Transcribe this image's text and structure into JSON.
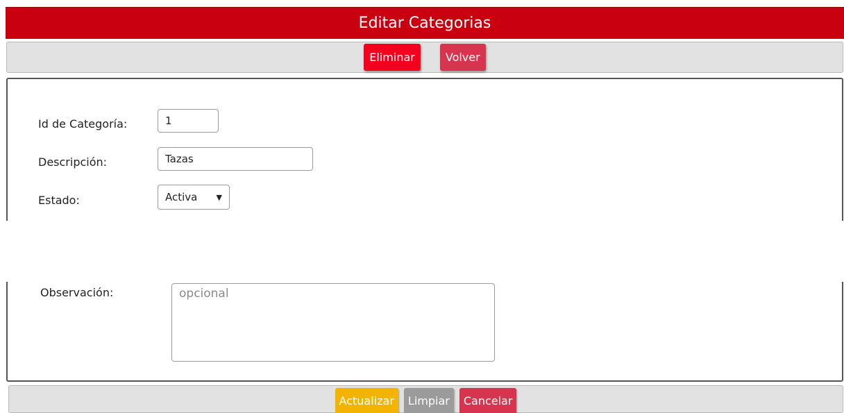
{
  "header": {
    "title": "Editar Categorias"
  },
  "toolbar": {
    "delete_label": "Eliminar",
    "back_label": "Volver"
  },
  "form": {
    "id_label": "Id de Categoría:",
    "id_value": "1",
    "description_label": "Descripción:",
    "description_value": "Tazas",
    "status_label": "Estado:",
    "status_value": "Activa",
    "observation_label": "Observación:",
    "observation_placeholder": "opcional"
  },
  "footer": {
    "update_label": "Actualizar",
    "clear_label": "Limpiar",
    "cancel_label": "Cancelar"
  },
  "colors": {
    "header_bg": "#c8000f",
    "delete_btn": "#f2001d",
    "back_btn": "#d7344f",
    "update_btn": "#f2b400",
    "clear_btn": "#9b9b9b",
    "cancel_btn": "#d7344f"
  },
  "icons": {
    "select_arrow": "dropdown-arrow-icon"
  }
}
